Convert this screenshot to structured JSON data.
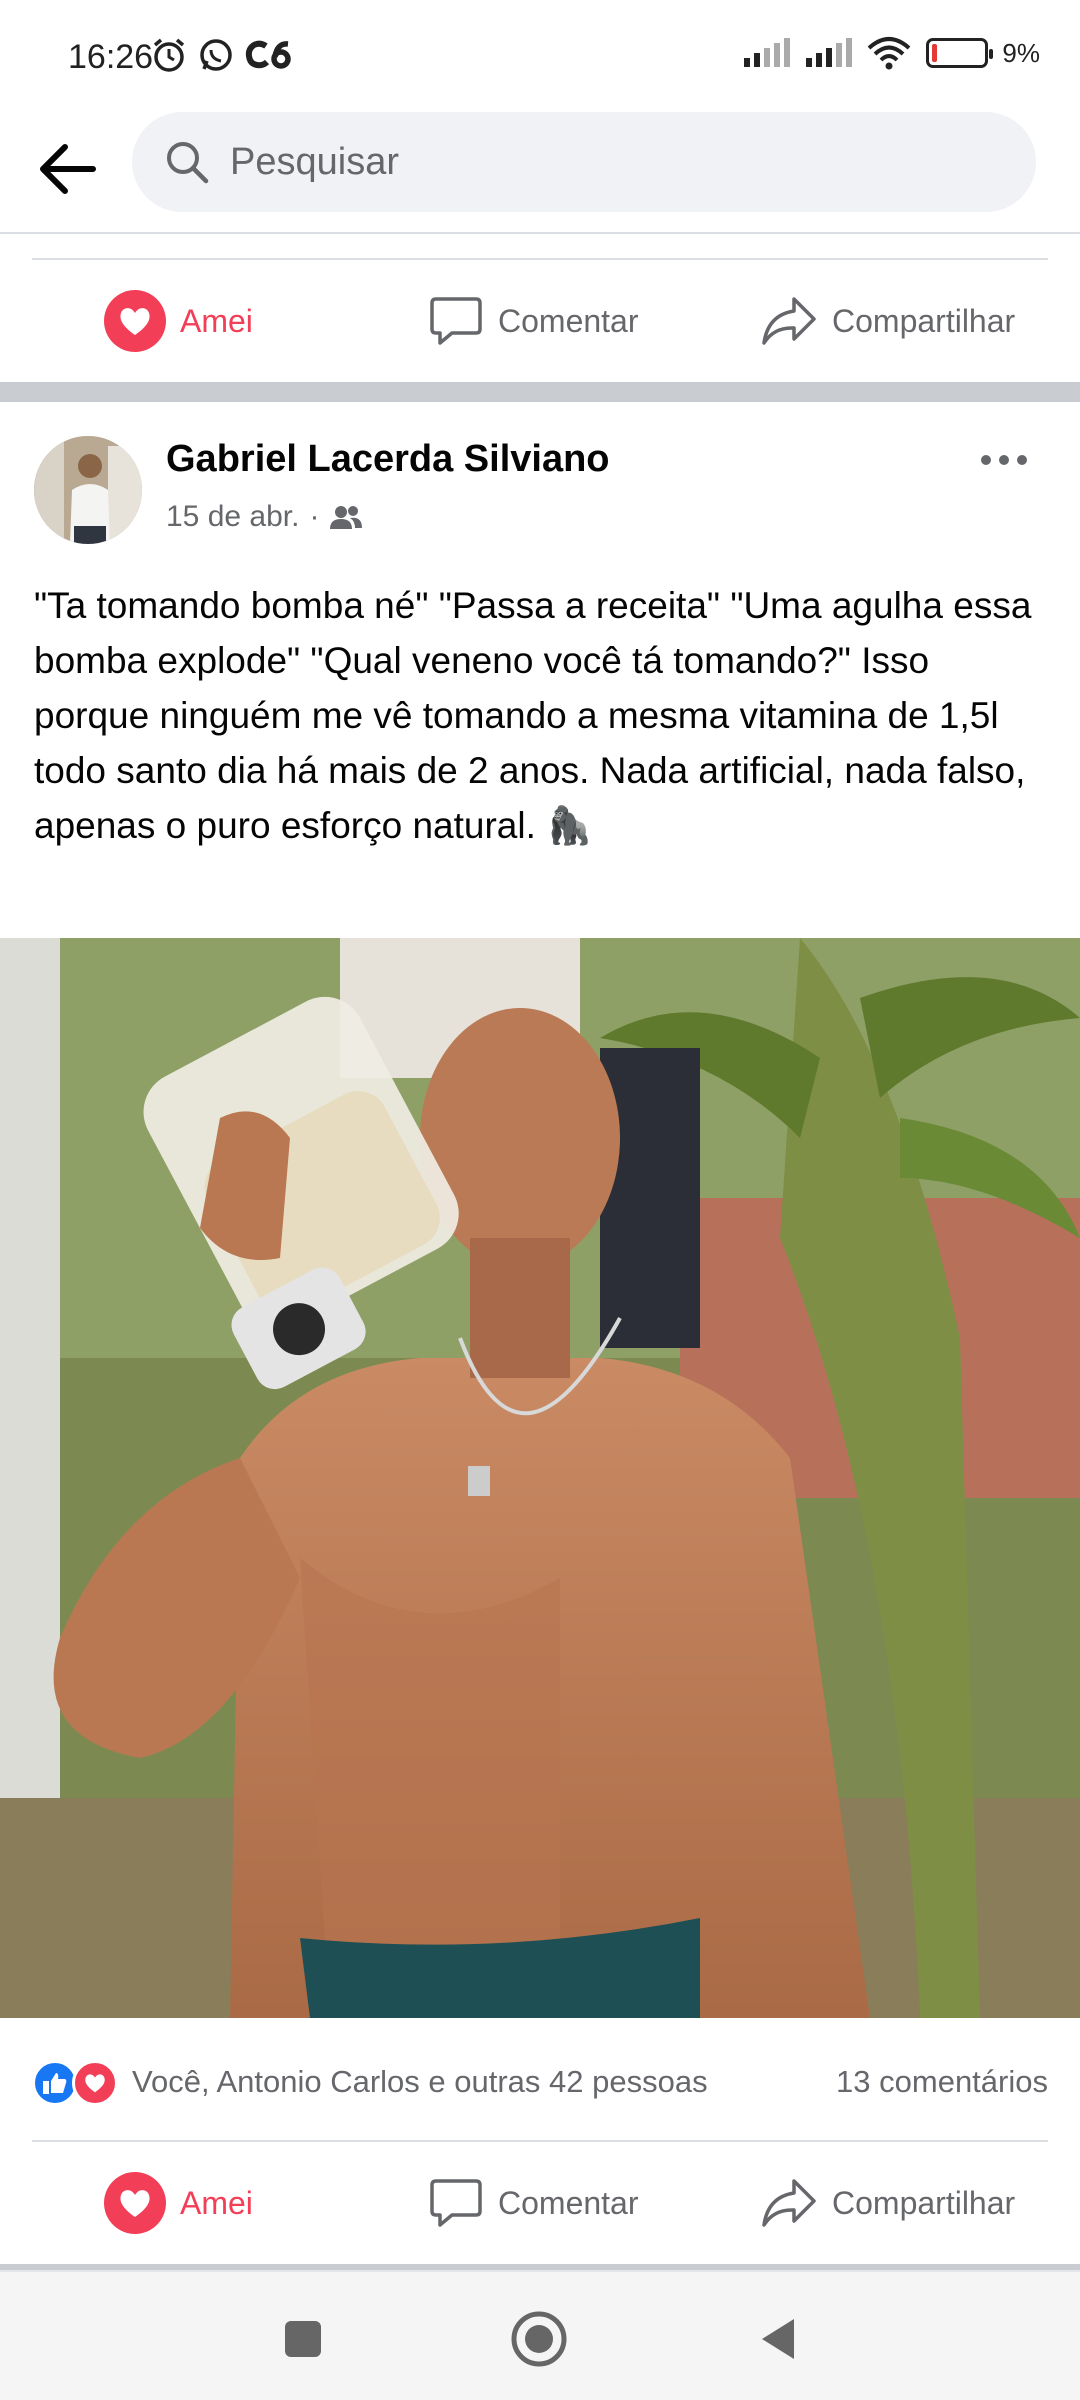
{
  "status_bar": {
    "time": "16:26",
    "left_icons": [
      "alarm-icon",
      "whatsapp-icon",
      "c6-bank-icon"
    ],
    "right_icons": [
      "signal-icon",
      "signal-icon",
      "wifi-icon",
      "battery-icon"
    ],
    "battery_percent": 9,
    "battery_text": "9%"
  },
  "header": {
    "back_icon": "arrow-left-icon",
    "search": {
      "placeholder": "Pesquisar",
      "value": ""
    }
  },
  "top_actions": {
    "love_label": "Amei",
    "comment_label": "Comentar",
    "share_label": "Compartilhar"
  },
  "post": {
    "author": "Gabriel Lacerda Silviano",
    "date": "15 de abr.",
    "separator": "·",
    "audience_icon": "friends-icon",
    "text": "\"Ta tomando bomba né\" \"Passa a receita\" \"Uma agulha essa bomba explode\" \"Qual veneno você tá tomando?\" Isso porque ninguém me vê tomando a mesma vitamina de 1,5l todo santo dia há mais de 2 anos. Nada artificial, nada falso, apenas o puro esforço natural. 🦍",
    "reactions_text": "Você, Antonio Carlos e outras 42 pessoas",
    "comments_text": "13 comentários",
    "love_label": "Amei",
    "comment_label": "Comentar",
    "share_label": "Compartilhar"
  },
  "colors": {
    "love": "#f33e58",
    "like": "#1877f2",
    "muted": "#65676b",
    "search_bg": "#f0f2f5"
  },
  "nav_bar": {
    "icons": [
      "recents-square-icon",
      "home-circle-icon",
      "back-triangle-icon"
    ]
  }
}
